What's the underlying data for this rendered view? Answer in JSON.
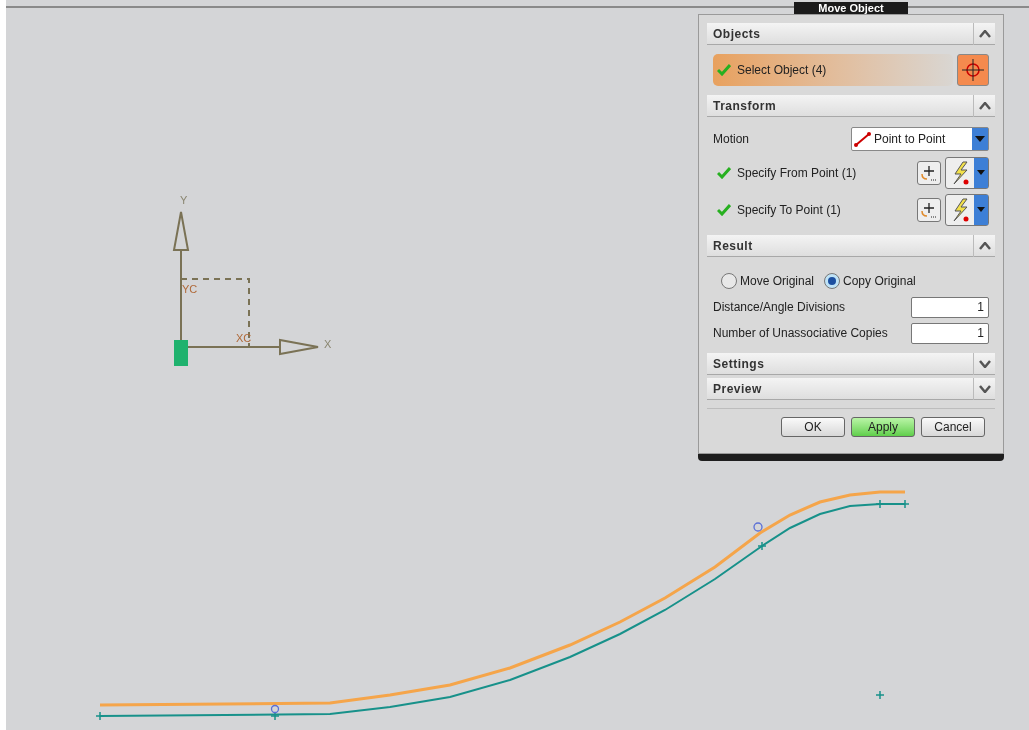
{
  "canvas": {
    "axis_labels": [
      "Y",
      "YC",
      "XC",
      "X"
    ]
  },
  "dialog": {
    "title": "Move Object",
    "sections": [
      {
        "kind": "objects",
        "header": "Objects",
        "expanded": true,
        "select": {
          "label": "Select Object (4)",
          "done": true
        }
      },
      {
        "kind": "transform",
        "header": "Transform",
        "expanded": true,
        "motion_label": "Motion",
        "motion_value": "Point to Point",
        "points": [
          {
            "label": "Specify From Point (1)",
            "done": true
          },
          {
            "label": "Specify To Point (1)",
            "done": true
          }
        ]
      },
      {
        "kind": "result",
        "header": "Result",
        "expanded": true,
        "options": [
          {
            "label": "Move Original",
            "selected": false
          },
          {
            "label": "Copy Original",
            "selected": true
          }
        ],
        "fields": [
          {
            "label": "Distance/Angle Divisions",
            "value": "1"
          },
          {
            "label": "Number of Unassociative Copies",
            "value": "1"
          }
        ]
      },
      {
        "header": "Settings",
        "expanded": false
      },
      {
        "header": "Preview",
        "expanded": false
      }
    ],
    "buttons": [
      {
        "label": "OK",
        "kind": "normal"
      },
      {
        "label": "Apply",
        "kind": "default"
      },
      {
        "label": "Cancel",
        "kind": "normal"
      }
    ]
  }
}
